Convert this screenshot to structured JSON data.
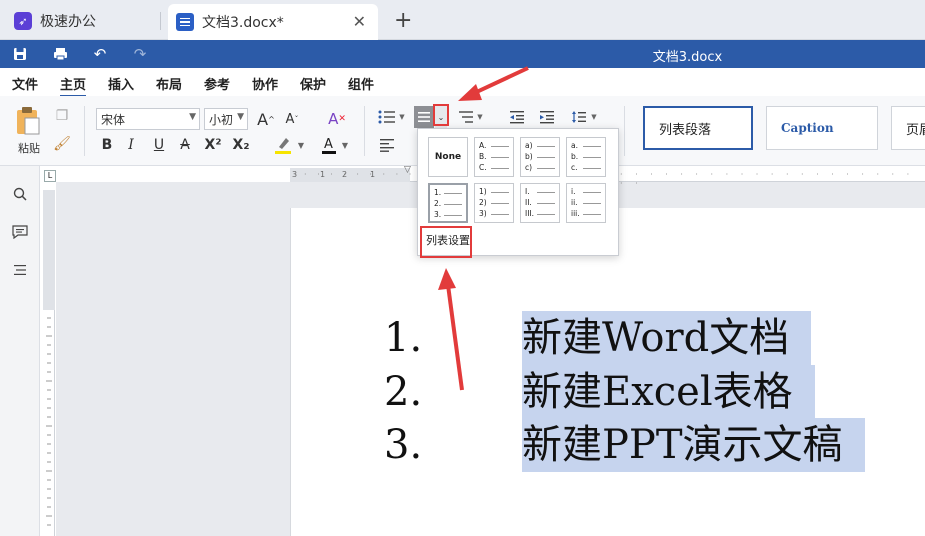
{
  "tabs": [
    {
      "label": "极速办公",
      "icon": "rocket-icon"
    },
    {
      "label": "文档3.docx*",
      "icon": "document-icon"
    }
  ],
  "titlebar": {
    "title": "文档3.docx"
  },
  "menu": [
    "文件",
    "主页",
    "插入",
    "布局",
    "参考",
    "协作",
    "保护",
    "组件"
  ],
  "ribbon": {
    "paste_label": "粘贴",
    "font_name": "宋体",
    "font_size": "小初",
    "bold": "B",
    "italic": "I",
    "underline": "U",
    "strike": "A",
    "superscript": "X²",
    "subscript": "X₂",
    "grow": "A",
    "shrink": "A",
    "styles": [
      "列表段落",
      "Caption",
      "页眉"
    ]
  },
  "list_menu": {
    "none_label": "None",
    "options": [
      [
        "A.",
        "B.",
        "C."
      ],
      [
        "a)",
        "b)",
        "c)"
      ],
      [
        "a.",
        "b.",
        "c."
      ],
      [
        "1.",
        "2.",
        "3."
      ],
      [
        "1)",
        "2)",
        "3)"
      ],
      [
        "I.",
        "II.",
        "III."
      ],
      [
        "i.",
        "ii.",
        "iii."
      ]
    ],
    "settings_label": "列表设置"
  },
  "document": {
    "items": [
      {
        "num": "1.",
        "text": "新建Word文档"
      },
      {
        "num": "2.",
        "text": "新建Excel表格"
      },
      {
        "num": "3.",
        "text": "新建PPT演示文稿"
      }
    ]
  },
  "ruler": {
    "marks": [
      "3",
      "1",
      "2",
      "1",
      "1",
      "1"
    ]
  },
  "colors": {
    "accent": "#2c5ba8",
    "annotation": "#e23b3b",
    "selection": "#c6d4ee"
  }
}
